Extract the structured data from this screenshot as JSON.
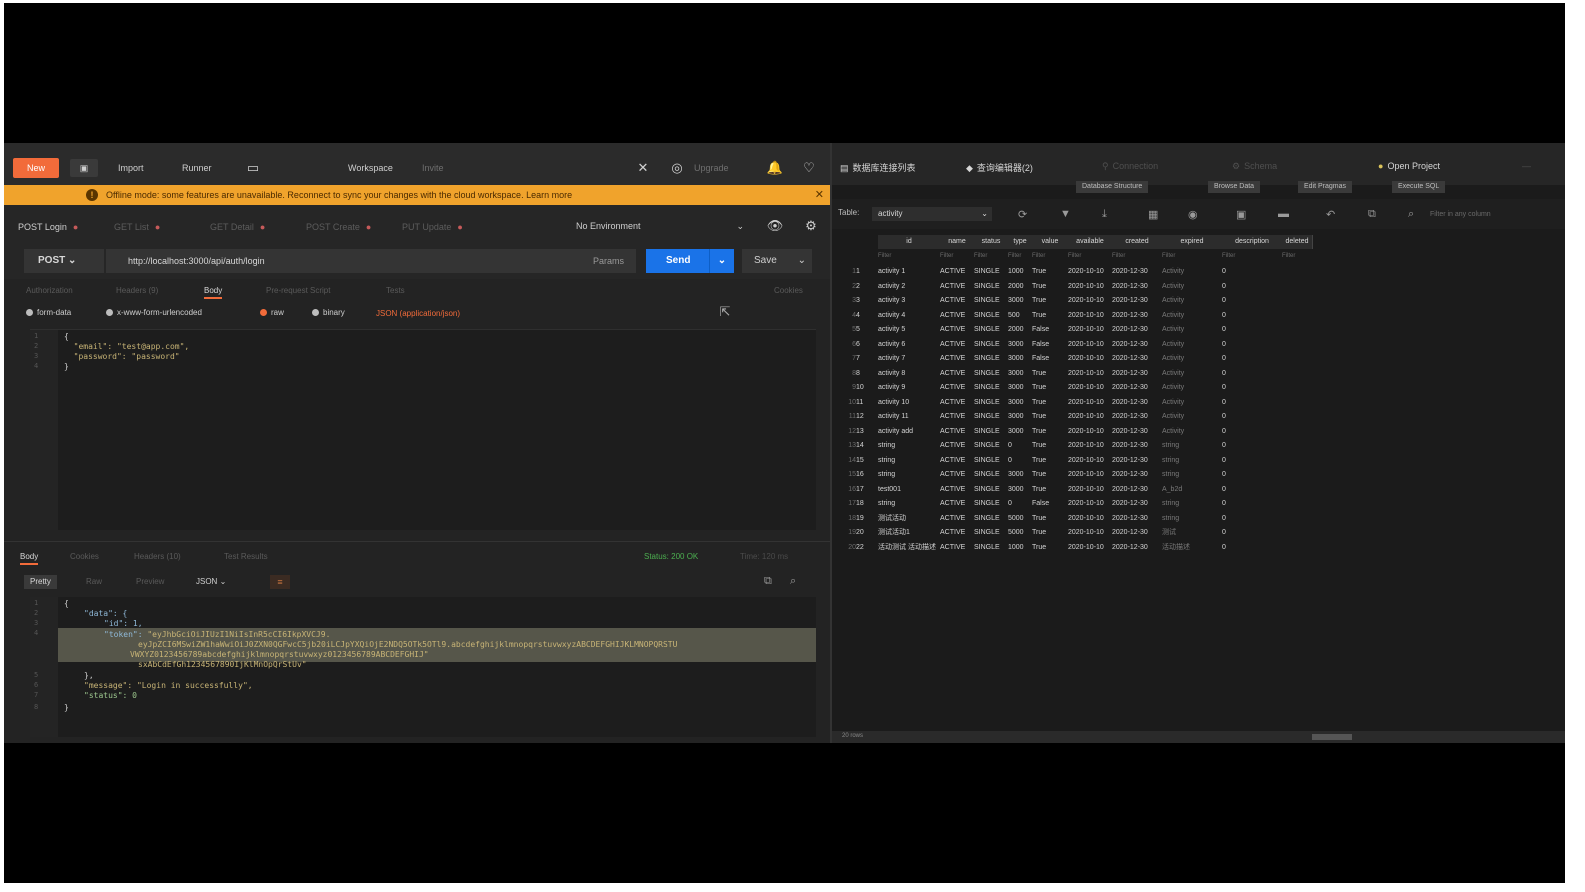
{
  "left": {
    "toolbar": {
      "new_label": "New",
      "import_label": "Import",
      "runner_label": "Runner",
      "workspace_label": "Workspace",
      "workspace_sub": "Invite",
      "upgrade_label": "Upgrade"
    },
    "banner": {
      "icon": "warning-icon",
      "message": "Offline mode: some features are unavailable. Reconnect to sync your changes with the cloud workspace.  Learn more"
    },
    "tabs": [
      {
        "label": "POST  Login",
        "active": true
      },
      {
        "label": "GET  List",
        "active": false
      },
      {
        "label": "GET  Detail",
        "active": false
      },
      {
        "label": "POST  Create",
        "active": false
      },
      {
        "label": "PUT  Update",
        "active": false
      }
    ],
    "environment": "No Environment",
    "request": {
      "method": "POST",
      "url": "http://localhost:3000/api/auth/login",
      "params_label": "Params",
      "send_label": "Send",
      "save_label": "Save"
    },
    "subtabs": [
      "Authorization",
      "Headers (9)",
      "Body",
      "Pre-request Script",
      "Tests",
      "Cookies"
    ],
    "body_modes": [
      "form-data",
      "x-www-form-urlencoded",
      "raw",
      "binary"
    ],
    "raw_type": "JSON (application/json)",
    "request_body": [
      "{",
      "  \"email\": \"test@app.com\",",
      "  \"password\": \"password\"",
      "}"
    ],
    "response": {
      "tabs": [
        "Body",
        "Cookies",
        "Headers (10)",
        "Test Results"
      ],
      "status": "Status: 200 OK",
      "time": "Time: 120 ms",
      "formats": [
        "Pretty",
        "Raw",
        "Preview"
      ],
      "format_type": "JSON",
      "body": {
        "open": "{",
        "data_key": "\"data\": {",
        "id_line": "\"id\": 1,",
        "token_key": "\"token\": ",
        "token_part1": "\"eyJhbGciOiJIUzI1NiIsInR5cCI6IkpXVCJ9.",
        "token_part2": "eyJpZCI6MSwiZW1haWwiOiJ0ZXN0QGFwcC5jb20iLCJpYXQiOjE2NDQ5OTk5OTl9.abcdefghijklmnopqrstuvwxyzABCDEFGHIJKLMNOPQRSTU",
        "token_part3": "VWXYZ0123456789abcdefghijklmnopqrstuvwxyz0123456789ABCDEFGHIJ\"",
        "token_part4": "sxAbCdEfGh1234567890IjKlMnOpQrStUv\"",
        "close_data": "},",
        "message_line": "\"message\": \"Login in successfully\",",
        "status_line": "\"status\": 0",
        "close": "}"
      }
    }
  },
  "right": {
    "tabs": [
      {
        "label": "数据库连接列表",
        "icon": "server-icon"
      },
      {
        "label": "查询编辑器(2)",
        "icon": "query-icon"
      },
      {
        "label": "Connection",
        "icon": "plug-icon"
      },
      {
        "label": "Schema",
        "icon": "schema-icon"
      },
      {
        "label": "Open Project",
        "icon": "folder-icon"
      }
    ],
    "subtabs": [
      "Database Structure",
      "Browse Data",
      "Edit Pragmas",
      "Execute SQL"
    ],
    "table_label": "Table:",
    "table_name": "activity",
    "filter_placeholder": "Filter in any column",
    "columns": [
      "id",
      "name",
      "status",
      "type",
      "value",
      "available",
      "created",
      "expired",
      "description",
      "deleted"
    ],
    "filter_row": [
      "Filter",
      "Filter",
      "Filter",
      "Filter",
      "Filter",
      "Filter",
      "Filter",
      "Filter",
      "Filter",
      "Filter"
    ],
    "rows": [
      [
        "1",
        "1",
        "activity 1",
        "ACTIVE",
        "SINGLE",
        "1000",
        "True",
        "2020-10-10",
        "2020-12-30",
        "Activity",
        "0"
      ],
      [
        "2",
        "2",
        "activity 2",
        "ACTIVE",
        "SINGLE",
        "2000",
        "True",
        "2020-10-10",
        "2020-12-30",
        "Activity",
        "0"
      ],
      [
        "3",
        "3",
        "activity 3",
        "ACTIVE",
        "SINGLE",
        "3000",
        "True",
        "2020-10-10",
        "2020-12-30",
        "Activity",
        "0"
      ],
      [
        "4",
        "4",
        "activity 4",
        "ACTIVE",
        "SINGLE",
        "500",
        "True",
        "2020-10-10",
        "2020-12-30",
        "Activity",
        "0"
      ],
      [
        "5",
        "5",
        "activity 5",
        "ACTIVE",
        "SINGLE",
        "2000",
        "False",
        "2020-10-10",
        "2020-12-30",
        "Activity",
        "0"
      ],
      [
        "6",
        "6",
        "activity 6",
        "ACTIVE",
        "SINGLE",
        "3000",
        "False",
        "2020-10-10",
        "2020-12-30",
        "Activity",
        "0"
      ],
      [
        "7",
        "7",
        "activity 7",
        "ACTIVE",
        "SINGLE",
        "3000",
        "False",
        "2020-10-10",
        "2020-12-30",
        "Activity",
        "0"
      ],
      [
        "8",
        "8",
        "activity 8",
        "ACTIVE",
        "SINGLE",
        "3000",
        "True",
        "2020-10-10",
        "2020-12-30",
        "Activity",
        "0"
      ],
      [
        "9",
        "10",
        "activity 9",
        "ACTIVE",
        "SINGLE",
        "3000",
        "True",
        "2020-10-10",
        "2020-12-30",
        "Activity",
        "0"
      ],
      [
        "10",
        "11",
        "activity 10",
        "ACTIVE",
        "SINGLE",
        "3000",
        "True",
        "2020-10-10",
        "2020-12-30",
        "Activity",
        "0"
      ],
      [
        "11",
        "12",
        "activity 11",
        "ACTIVE",
        "SINGLE",
        "3000",
        "True",
        "2020-10-10",
        "2020-12-30",
        "Activity",
        "0"
      ],
      [
        "12",
        "13",
        "activity add",
        "ACTIVE",
        "SINGLE",
        "3000",
        "True",
        "2020-10-10",
        "2020-12-30",
        "Activity",
        "0"
      ],
      [
        "13",
        "14",
        "string",
        "ACTIVE",
        "SINGLE",
        "0",
        "True",
        "2020-10-10",
        "2020-12-30",
        "string",
        "0"
      ],
      [
        "14",
        "15",
        "string",
        "ACTIVE",
        "SINGLE",
        "0",
        "True",
        "2020-10-10",
        "2020-12-30",
        "string",
        "0"
      ],
      [
        "15",
        "16",
        "string",
        "ACTIVE",
        "SINGLE",
        "3000",
        "True",
        "2020-10-10",
        "2020-12-30",
        "string",
        "0"
      ],
      [
        "16",
        "17",
        "test001",
        "ACTIVE",
        "SINGLE",
        "3000",
        "True",
        "2020-10-10",
        "2020-12-30",
        "A_b2d",
        "0"
      ],
      [
        "17",
        "18",
        "string",
        "ACTIVE",
        "SINGLE",
        "0",
        "False",
        "2020-10-10",
        "2020-12-30",
        "string",
        "0"
      ],
      [
        "18",
        "19",
        "测试活动",
        "ACTIVE",
        "SINGLE",
        "5000",
        "True",
        "2020-10-10",
        "2020-12-30",
        "string",
        "0"
      ],
      [
        "19",
        "20",
        "测试活动1",
        "ACTIVE",
        "SINGLE",
        "5000",
        "True",
        "2020-10-10",
        "2020-12-30",
        "测试",
        "0"
      ],
      [
        "20",
        "22",
        "活动测试 活动描述",
        "ACTIVE",
        "SINGLE",
        "1000",
        "True",
        "2020-10-10",
        "2020-12-30",
        "活动描述",
        "0"
      ]
    ],
    "status_text": "20 rows"
  },
  "colors": {
    "accent_orange": "#f26b3a",
    "send_blue": "#1a73e8",
    "banner_yellow": "#f0a32c",
    "background_dark": "#232323"
  }
}
